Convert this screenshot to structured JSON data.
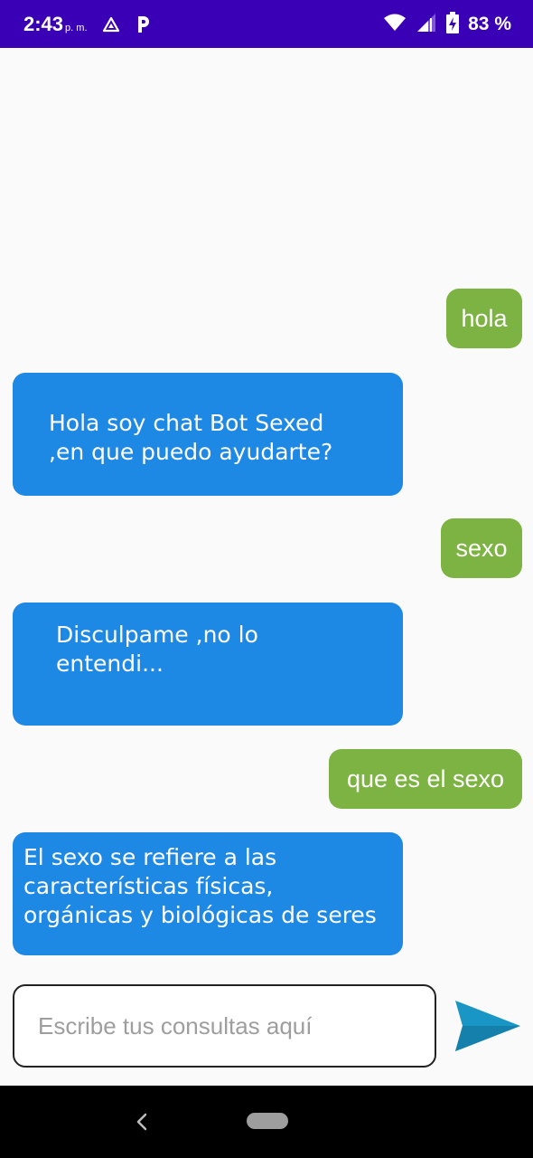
{
  "status_bar": {
    "time": "2:43",
    "ampm": "p. m.",
    "battery_percent": "83 %",
    "icons": [
      "drive-icon",
      "parking-icon",
      "wifi-icon",
      "signal-icon",
      "battery-charging-icon"
    ]
  },
  "messages": [
    {
      "sender": "user",
      "text": "hola"
    },
    {
      "sender": "bot",
      "lines": [
        "Hola soy chat Bot Sexed",
        ",en que puedo ayudarte?"
      ]
    },
    {
      "sender": "user",
      "text": "sexo"
    },
    {
      "sender": "bot",
      "lines": [
        "Disculpame ,no lo",
        "entendi..."
      ]
    },
    {
      "sender": "user",
      "text": "que es el sexo"
    },
    {
      "sender": "bot",
      "lines": [
        "El sexo se refiere a las",
        "características físicas,",
        "orgánicas y biológicas de seres"
      ]
    }
  ],
  "input": {
    "placeholder": "Escribe tus consultas aquí",
    "value": ""
  },
  "send_icon": "send-arrow-icon",
  "colors": {
    "status_bar": "#3a00b5",
    "user_bubble": "#7cb342",
    "bot_bubble": "#1e88e5",
    "send_icon": "#1a96c6"
  }
}
